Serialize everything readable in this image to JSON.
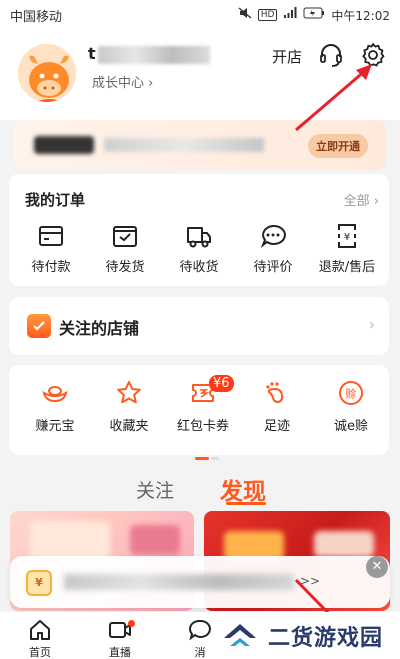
{
  "status_bar": {
    "carrier": "中国移动",
    "time": "中午12:02",
    "battery": "▭"
  },
  "header": {
    "username_initial": "t",
    "growth_center": "成长中心 ›",
    "open_store": "开店"
  },
  "vip_banner": {
    "button_label": "立即开通"
  },
  "orders": {
    "title": "我的订单",
    "all_label": "全部 ›",
    "items": [
      {
        "label": "待付款",
        "icon": "wallet-icon"
      },
      {
        "label": "待发货",
        "icon": "box-icon"
      },
      {
        "label": "待收货",
        "icon": "truck-icon"
      },
      {
        "label": "待评价",
        "icon": "chat-icon"
      },
      {
        "label": "退款/售后",
        "icon": "refund-icon"
      }
    ]
  },
  "stores": {
    "title": "关注的店铺",
    "chevron": "›"
  },
  "tools": {
    "items": [
      {
        "label": "赚元宝",
        "icon": "ingot-icon"
      },
      {
        "label": "收藏夹",
        "icon": "star-icon"
      },
      {
        "label": "红包卡券",
        "icon": "coupon-icon",
        "badge": "¥6"
      },
      {
        "label": "足迹",
        "icon": "footprint-icon"
      },
      {
        "label": "诚e赊",
        "icon": "credit-icon",
        "icon_text": "赊"
      }
    ]
  },
  "feed_tabs": {
    "follow": "关注",
    "discover": "发现"
  },
  "popup": {
    "more": ">>",
    "close": "✕",
    "icon_text": "¥"
  },
  "tabbar": {
    "home": "首页",
    "live": "直播",
    "messages": "消"
  },
  "watermark": {
    "text": "二货游戏园"
  },
  "colors": {
    "accent": "#ff5a1f",
    "brand_blue": "#2a3b6b"
  }
}
